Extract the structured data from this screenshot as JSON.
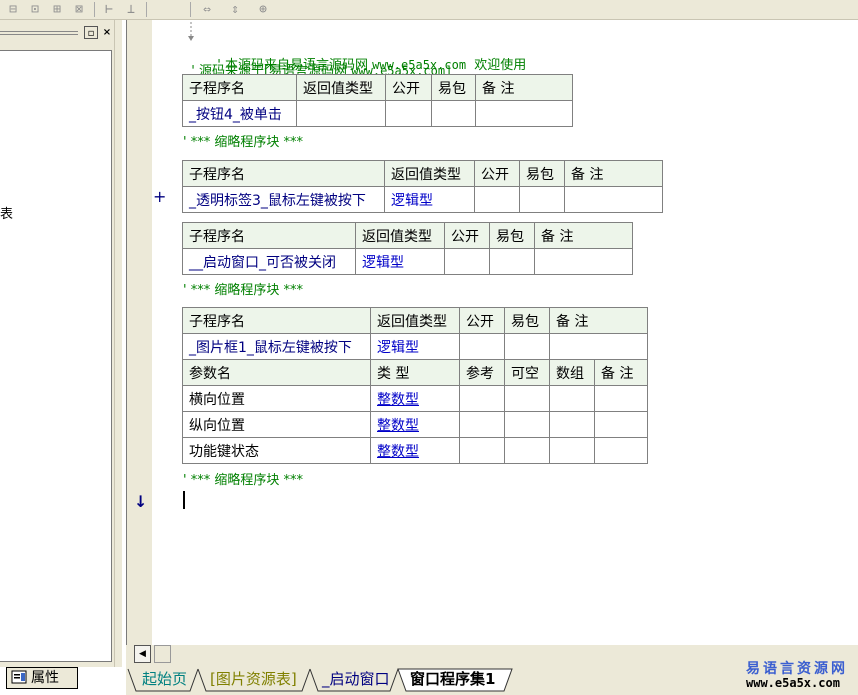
{
  "toolbar": {
    "icons": [
      "layout-left-icon",
      "layout-center-icon",
      "layout-top-icon",
      "layout-spread-icon",
      "h-space-icon",
      "v-space-icon",
      "h-size-icon",
      "v-size-icon",
      "center-icon"
    ],
    "glyphs": [
      "⊟",
      "⊡",
      "⊞",
      "⊠",
      "⊢",
      "⊥",
      "⇔",
      "⇕",
      "⊕"
    ]
  },
  "left_panel": {
    "pin_glyph": "▫",
    "close_glyph": "×",
    "cut_text": "表",
    "props_tab": "属性"
  },
  "code": {
    "comment1_prefix": "' ",
    "comment1_text": "本源码来自易语言源码网 ",
    "comment1_url": "www.e5a5x.com",
    "comment1_tail": "  欢迎使用",
    "comment2_text": "' 源码来源于[易语言源码网 ",
    "comment2_url": "www.e5a5x.com]",
    "collapsed": "' *** 缩略程序块 ***"
  },
  "headers": {
    "sub_name": "子程序名",
    "return_type": "返回值类型",
    "public": "公开",
    "easy_pkg": "易包",
    "remark": "备 注",
    "param_name": "参数名",
    "type": "类 型",
    "ref": "参考",
    "nullable": "可空",
    "array": "数组"
  },
  "subs": [
    {
      "name": "_按钮4_被单击",
      "return_type": ""
    },
    {
      "name": "_透明标签3_鼠标左键被按下",
      "return_type": "逻辑型"
    },
    {
      "name": "__启动窗口_可否被关闭",
      "return_type": "逻辑型"
    },
    {
      "name": "_图片框1_鼠标左键被按下",
      "return_type": "逻辑型"
    }
  ],
  "params": [
    {
      "name": "横向位置",
      "type": "整数型"
    },
    {
      "name": "纵向位置",
      "type": "整数型"
    },
    {
      "name": "功能键状态",
      "type": "整数型"
    }
  ],
  "gutter": {
    "expand_glyph": "+",
    "arrow_glyph": "↓"
  },
  "tabs": [
    "起始页",
    "[图片资源表]",
    "_启动窗口",
    "窗口程序集1"
  ],
  "watermark": {
    "cn": "易语言资源网",
    "url": "www.e5a5x.com"
  },
  "colors": {
    "comment": "#008000",
    "name": "#000080",
    "type": "#0000c8",
    "header_bg": "#edf5ea",
    "tab_start": "#008080",
    "tab_res": "#808000",
    "tab_win": "#000080"
  }
}
